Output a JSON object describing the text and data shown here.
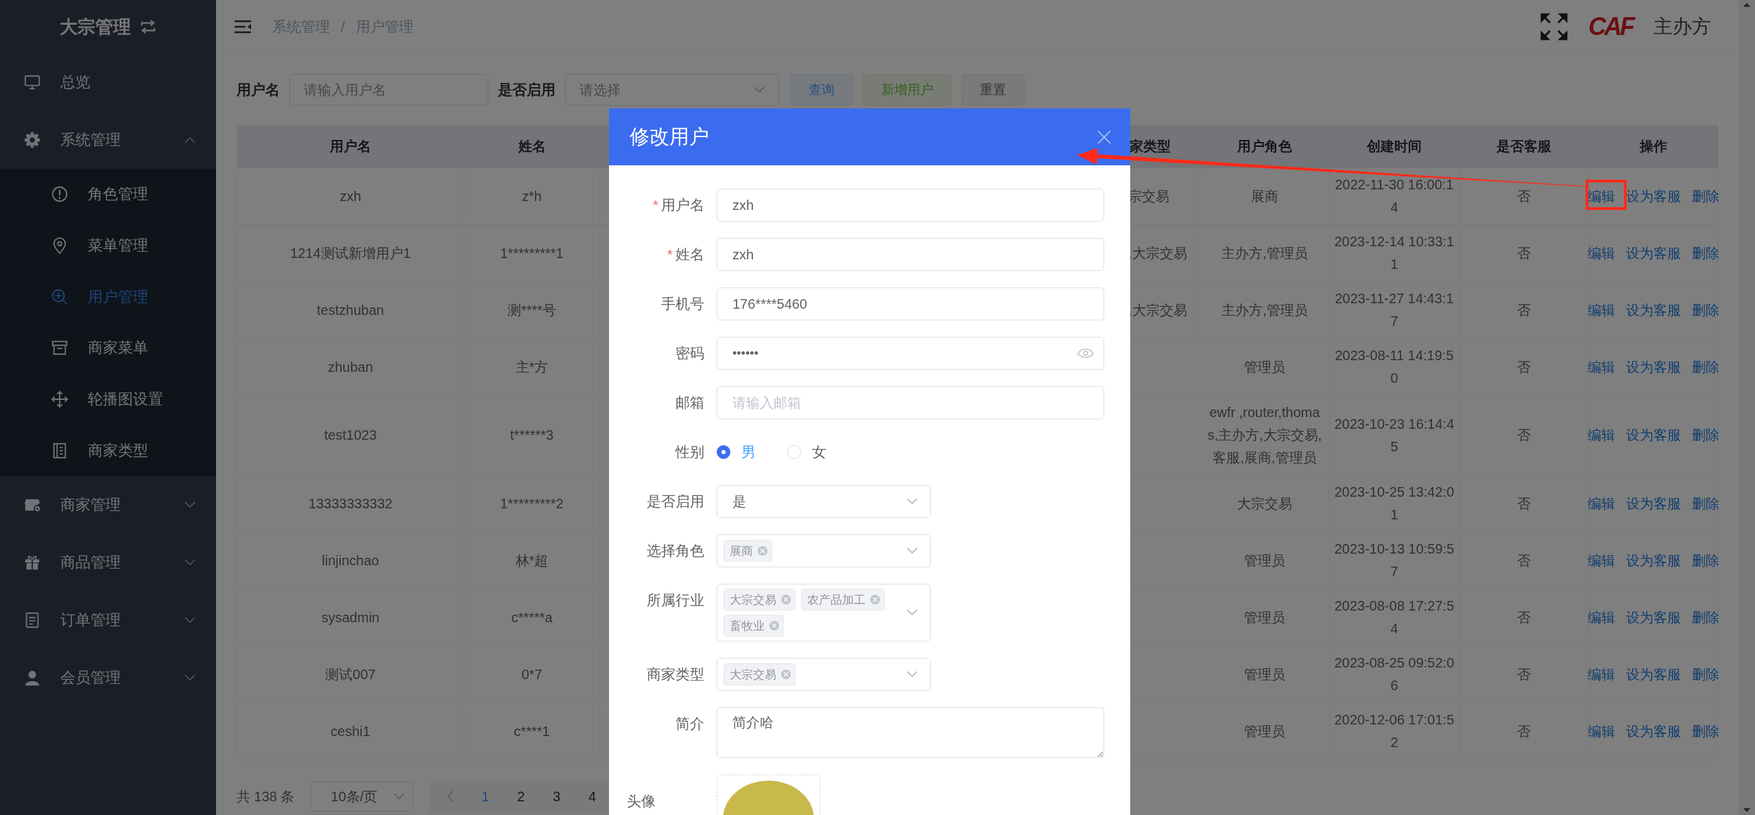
{
  "sidebar": {
    "title": "大宗管理",
    "items": [
      {
        "label": "总览",
        "kind": "link"
      },
      {
        "label": "系统管理",
        "kind": "group",
        "expanded": true,
        "children": [
          {
            "label": "角色管理",
            "selected": false
          },
          {
            "label": "菜单管理",
            "selected": false
          },
          {
            "label": "用户管理",
            "selected": true
          },
          {
            "label": "商家菜单",
            "selected": false
          },
          {
            "label": "轮播图设置",
            "selected": false
          },
          {
            "label": "商家类型",
            "selected": false
          }
        ]
      },
      {
        "label": "商家管理",
        "kind": "group",
        "expanded": false
      },
      {
        "label": "商品管理",
        "kind": "group",
        "expanded": false
      },
      {
        "label": "订单管理",
        "kind": "group",
        "expanded": false
      },
      {
        "label": "会员管理",
        "kind": "group",
        "expanded": false
      }
    ]
  },
  "header": {
    "breadcrumb": [
      "系统管理",
      "用户管理"
    ],
    "separator": "/",
    "logo": "CAF",
    "organizer": "主办方"
  },
  "filters": {
    "fields": [
      {
        "label": "用户名",
        "kind": "input",
        "placeholder": "请输入用户名"
      },
      {
        "label": "是否启用",
        "kind": "select",
        "placeholder": "请选择"
      }
    ],
    "buttons": [
      {
        "label": "查询",
        "kind": "primary"
      },
      {
        "label": "新增用户",
        "kind": "success"
      },
      {
        "label": "重置",
        "kind": "default"
      }
    ]
  },
  "table": {
    "columns": [
      "用户名",
      "姓名",
      "家类型",
      "用户角色",
      "创建时间",
      "是否客服",
      "操作"
    ],
    "rows": [
      {
        "username": "zxh",
        "name": "z*h",
        "column_3": "宗交易",
        "roles": "展商",
        "created": "2022-11-30 16:00:14",
        "customer_service": "否",
        "actions": [
          "编辑",
          "设为客服",
          "删除"
        ]
      },
      {
        "username": "1214测试新增用户1",
        "name": "1*********1",
        "column_3": ",大宗交易",
        "roles": "主办方,管理员",
        "created": "2023-12-14 10:33:11",
        "customer_service": "否",
        "actions": [
          "编辑",
          "设为客服",
          "删除"
        ]
      },
      {
        "username": "testzhuban",
        "name": "测****号",
        "column_3": ",大宗交易",
        "roles": "主办方,管理员",
        "created": "2023-11-27 14:43:17",
        "customer_service": "否",
        "actions": [
          "编辑",
          "设为客服",
          "删除"
        ]
      },
      {
        "username": "zhuban",
        "name": "主*方",
        "roles": "管理员",
        "created": "2023-08-11 14:19:50",
        "customer_service": "否",
        "actions": [
          "编辑",
          "设为客服",
          "删除"
        ]
      },
      {
        "username": "test1023",
        "name": "t******3",
        "roles": "ewfr ,router,thomas,主办方,大宗交易,客服,展商,管理员",
        "created": "2023-10-23 16:14:45",
        "customer_service": "否",
        "actions": [
          "编辑",
          "设为客服",
          "删除"
        ]
      },
      {
        "username": "13333333332",
        "name": "1*********2",
        "roles": "大宗交易",
        "created": "2023-10-25 13:42:01",
        "customer_service": "否",
        "actions": [
          "编辑",
          "设为客服",
          "删除"
        ]
      },
      {
        "username": "linjinchao",
        "name": "林*超",
        "roles": "管理员",
        "created": "2023-10-13 10:59:57",
        "customer_service": "否",
        "actions": [
          "编辑",
          "设为客服",
          "删除"
        ]
      },
      {
        "username": "sysadmin",
        "name": "c*****a",
        "roles": "管理员",
        "created": "2023-08-08 17:27:54",
        "customer_service": "否",
        "actions": [
          "编辑",
          "设为客服",
          "删除"
        ]
      },
      {
        "username": "测试007",
        "name": "0*7",
        "roles": "管理员",
        "created": "2023-08-25 09:52:06",
        "customer_service": "否",
        "actions": [
          "编辑",
          "设为客服",
          "删除"
        ]
      },
      {
        "username": "ceshi1",
        "name": "c****1",
        "roles": "管理员",
        "created": "2020-12-06 17:01:52",
        "customer_service": "否",
        "actions": [
          "编辑",
          "设为客服",
          "删除"
        ]
      }
    ]
  },
  "pagination": {
    "total": "共 138 条",
    "page_size": "10条/页",
    "pages": [
      {
        "label": "1",
        "selected": true
      },
      {
        "label": "2",
        "selected": false
      },
      {
        "label": "3",
        "selected": false
      },
      {
        "label": "4",
        "selected": false
      }
    ]
  },
  "dialog": {
    "title": "修改用户",
    "required_mark": "*",
    "fields": [
      {
        "label": "用户名",
        "required": true,
        "kind": "text",
        "value": "zxh"
      },
      {
        "label": "姓名",
        "required": true,
        "kind": "text",
        "value": "zxh"
      },
      {
        "label": "手机号",
        "required": false,
        "kind": "text",
        "value": "176****5460"
      },
      {
        "label": "密码",
        "required": false,
        "kind": "password",
        "value": "••••••"
      },
      {
        "label": "邮箱",
        "required": false,
        "kind": "text",
        "placeholder": "请输入邮箱"
      },
      {
        "label": "性别",
        "required": false,
        "kind": "radio",
        "options": [
          {
            "label": "男",
            "selected": true
          },
          {
            "label": "女",
            "selected": false
          }
        ]
      },
      {
        "label": "是否启用",
        "required": false,
        "kind": "select",
        "value": "是"
      },
      {
        "label": "选择角色",
        "required": false,
        "kind": "tags",
        "tags": [
          "展商"
        ]
      },
      {
        "label": "所属行业",
        "required": false,
        "kind": "tags",
        "tags": [
          "大宗交易",
          "农产品加工",
          "畜牧业"
        ]
      },
      {
        "label": "商家类型",
        "required": false,
        "kind": "tags",
        "tags": [
          "大宗交易"
        ]
      },
      {
        "label": "简介",
        "required": false,
        "kind": "textarea",
        "value": "简介哈"
      },
      {
        "label": "头像",
        "required": false,
        "kind": "upload"
      }
    ]
  }
}
